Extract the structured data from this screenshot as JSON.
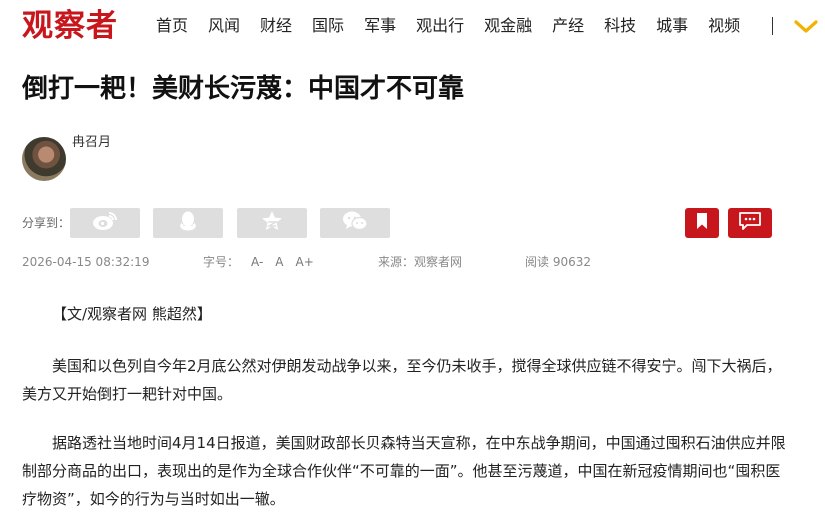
{
  "header": {
    "logo": "观察者",
    "nav": [
      "首页",
      "风闻",
      "财经",
      "国际",
      "军事",
      "观出行",
      "观金融",
      "产经",
      "科技",
      "城事",
      "视频"
    ],
    "accent": "#c8161d"
  },
  "article": {
    "title": "倒打一耙！美财长污蔑：中国才不可靠",
    "author": "冉召月",
    "share_label": "分享到：",
    "share_icons": [
      "weibo-icon",
      "qq-icon",
      "qzone-icon",
      "wechat-icon"
    ],
    "actions": [
      "bookmark-icon",
      "comment-icon"
    ],
    "date": "2026-04-15 08:32:19",
    "font_size": {
      "label": "字号：",
      "options": [
        "A-",
        "A",
        "A+"
      ]
    },
    "source": "来源：观察者网",
    "reads": "阅读 90632",
    "byline": "【文/观察者网 熊超然】",
    "paragraphs": [
      "美国和以色列自今年2月底公然对伊朗发动战争以来，至今仍未收手，搅得全球供应链不得安宁。闯下大祸后，美方又开始倒打一耙针对中国。",
      "据路透社当地时间4月14日报道，美国财政部长贝森特当天宣称，在中东战争期间，中国通过囤积石油供应并限制部分商品的出口，表现出的是作为全球合作伙伴“不可靠的一面”。他甚至污蔑道，中国在新冠疫情期间也“囤积医疗物资”，如今的行为与当时如出一辙。"
    ]
  }
}
